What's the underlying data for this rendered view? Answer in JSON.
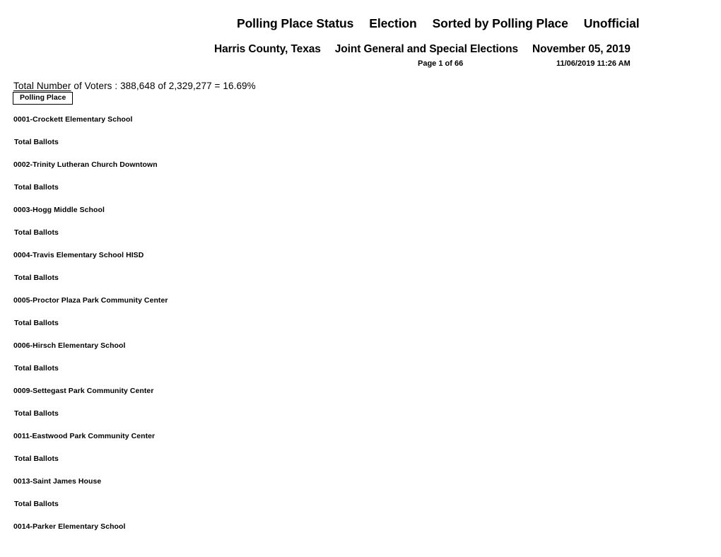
{
  "document": {
    "title_segments": [
      "Polling Place Status",
      "Election",
      "Sorted by Polling Place",
      "Unofficial"
    ],
    "subtitle_segments": [
      "Harris County, Texas",
      "Joint General and Special Elections",
      "November 05, 2019"
    ],
    "page_indicator": "Page 1 of 66",
    "generated_timestamp": "11/06/2019 11:26 AM"
  },
  "summary": {
    "label_underlined": "Total Number",
    "label_rest": " of Voters : 388,648 of 2,329,277 = 16.69%",
    "voters_counted": "388,648",
    "registered_voters": "2,329,277",
    "turnout_percent": "16.69%"
  },
  "column_header": {
    "label": "Polling Place"
  },
  "rows": [
    {
      "type": "place",
      "text": "0001-Crockett Elementary School"
    },
    {
      "type": "total",
      "text": "Total Ballots"
    },
    {
      "type": "place",
      "text": "0002-Trinity Lutheran Church Downtown"
    },
    {
      "type": "total",
      "text": "Total Ballots"
    },
    {
      "type": "place",
      "text": "0003-Hogg Middle School"
    },
    {
      "type": "total",
      "text": "Total Ballots"
    },
    {
      "type": "place",
      "text": "0004-Travis Elementary School HISD"
    },
    {
      "type": "total",
      "text": "Total Ballots"
    },
    {
      "type": "place",
      "text": "0005-Proctor Plaza Park Community Center"
    },
    {
      "type": "total",
      "text": "Total Ballots"
    },
    {
      "type": "place",
      "text": "0006-Hirsch Elementary School"
    },
    {
      "type": "total",
      "text": "Total Ballots"
    },
    {
      "type": "place",
      "text": "0009-Settegast Park Community Center"
    },
    {
      "type": "total",
      "text": "Total Ballots"
    },
    {
      "type": "place",
      "text": "0011-Eastwood Park Community Center"
    },
    {
      "type": "total",
      "text": "Total Ballots"
    },
    {
      "type": "place",
      "text": "0013-Saint James House"
    },
    {
      "type": "total",
      "text": "Total Ballots"
    },
    {
      "type": "place",
      "text": "0014-Parker Elementary School"
    }
  ]
}
